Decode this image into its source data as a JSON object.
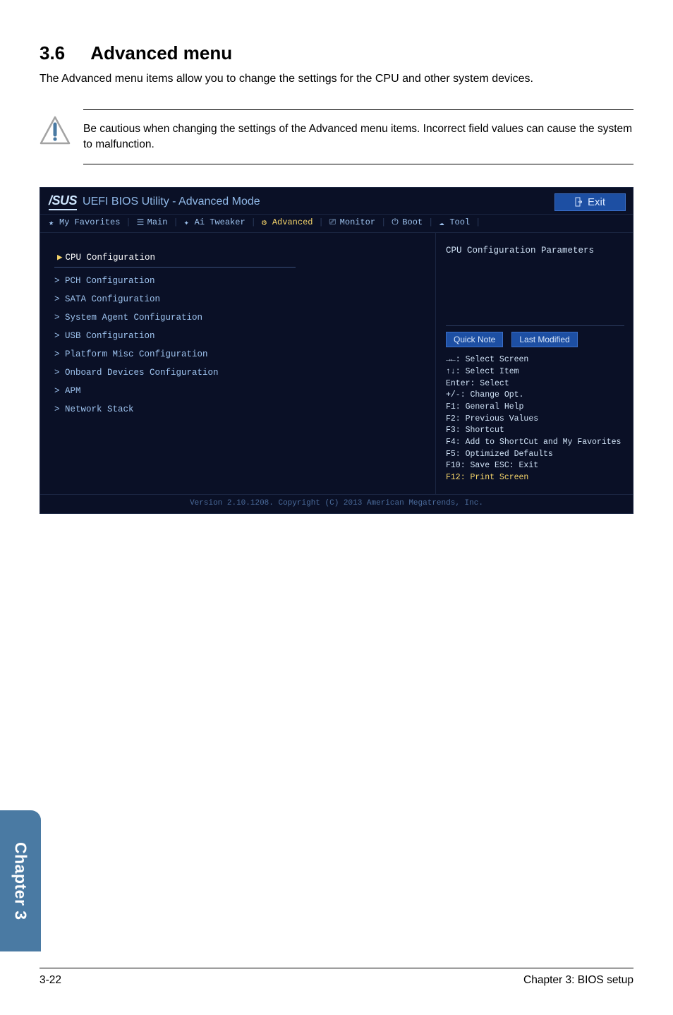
{
  "section": {
    "number": "3.6",
    "title": "Advanced menu",
    "lead": "The Advanced menu items allow you to change the settings for the CPU and other system devices."
  },
  "note": {
    "text": "Be cautious when changing the settings of the Advanced menu items. Incorrect field values can cause the system to malfunction."
  },
  "bios": {
    "logo": "/SUS",
    "subtitle": "UEFI BIOS Utility - Advanced Mode",
    "exit_label": "Exit",
    "tabs": {
      "favorites": "My Favorites",
      "main": "Main",
      "tweaker": "Ai Tweaker",
      "advanced": "Advanced",
      "monitor": "Monitor",
      "boot": "Boot",
      "tool": "Tool"
    },
    "items": [
      "CPU Configuration",
      "PCH Configuration",
      "SATA Configuration",
      "System Agent Configuration",
      "USB Configuration",
      "Platform Misc Configuration",
      "Onboard Devices Configuration",
      "APM",
      "Network Stack"
    ],
    "right_desc": "CPU Configuration Parameters",
    "quick_note": "Quick Note",
    "last_modified": "Last Modified",
    "hints": {
      "l1": "→←: Select Screen",
      "l2": "↑↓: Select Item",
      "l3": "Enter: Select",
      "l4": "+/-: Change Opt.",
      "l5": "F1: General Help",
      "l6": "F2: Previous Values",
      "l7": "F3: Shortcut",
      "l8": "F4: Add to ShortCut and My Favorites",
      "l9": "F5: Optimized Defaults",
      "l10": "F10: Save   ESC: Exit",
      "l11": "F12: Print Screen"
    },
    "footer": "Version 2.10.1208. Copyright (C) 2013 American Megatrends, Inc."
  },
  "pageFooter": {
    "left": "3-22",
    "right": "Chapter 3: BIOS setup"
  },
  "chapterTab": "Chapter 3"
}
